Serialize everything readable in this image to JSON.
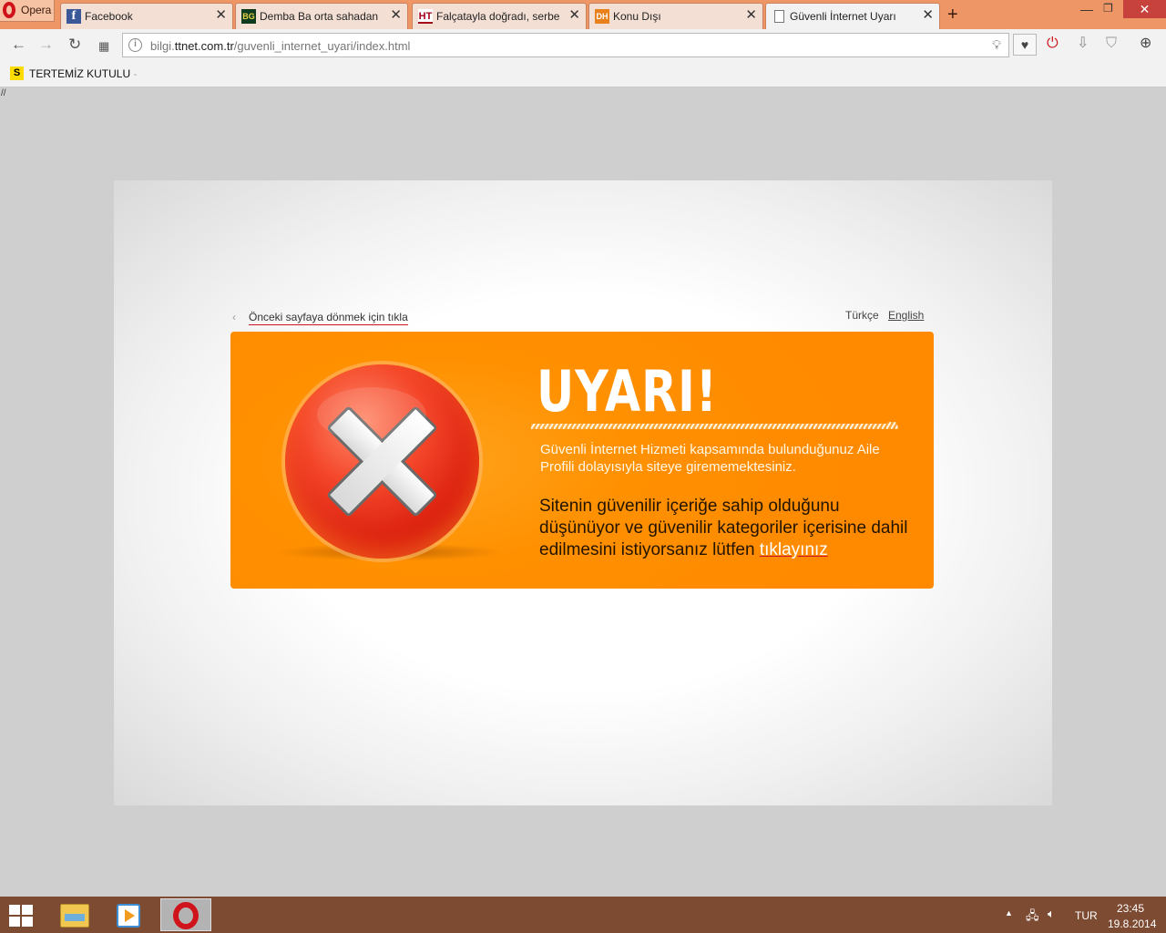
{
  "browser": {
    "menu_label": "Opera",
    "tabs": [
      {
        "title": "Facebook",
        "favicon": "f"
      },
      {
        "title": "Demba Ba orta sahadan at",
        "favicon": "BG"
      },
      {
        "title": "Falçatayla doğradı, serbest",
        "favicon": "HT"
      },
      {
        "title": "Konu Dışı",
        "favicon": "DH"
      },
      {
        "title": "Güvenli İnternet Uyarı",
        "favicon": ""
      }
    ],
    "active_tab": 4,
    "new_tab": "+",
    "window_controls": {
      "minimize": "—",
      "maximize": "❐",
      "close": "✕"
    },
    "address": {
      "prefix": "bilgi.",
      "domain": "ttnet.com.tr",
      "path": "/guvenli_internet_uyari/index.html"
    },
    "nav": {
      "back": "←",
      "forward": "→",
      "reload": "↻"
    },
    "bookmarks": [
      {
        "icon": "S",
        "label": "TERTEMİZ KUTULU",
        "suffix": "-"
      }
    ]
  },
  "page": {
    "slashes": "//",
    "back_chevron": "‹",
    "back_link": "Önceki sayfaya dönmek için tıkla",
    "lang_tr": "Türkçe",
    "lang_en": "English",
    "warning_title": "UYARI!",
    "message_1": "Güvenli İnternet Hizmeti kapsamında bulunduğunuz Aile Profili dolayısıyla siteye girememektesiniz.",
    "message_2": "Sitenin güvenilir içeriğe sahip olduğunu düşünüyor ve güvenilir kategoriler içerisine dahil edilmesini istiyorsanız lütfen",
    "message_link": "tıklayınız",
    "colors": {
      "box": "#ff8c00",
      "circle": "#e2220c",
      "accent_underline": "#d0122b"
    }
  },
  "taskbar": {
    "tray_arrow": "▲",
    "language": "TUR",
    "time": "23:45",
    "date": "19.8.2014"
  }
}
